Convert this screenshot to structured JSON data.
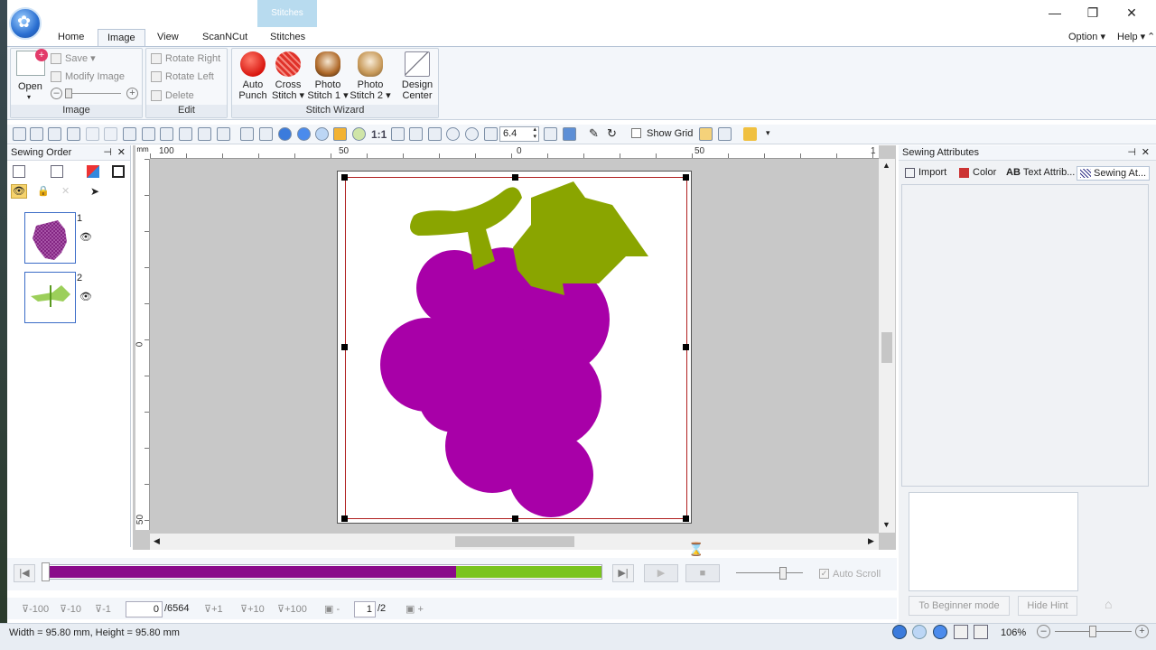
{
  "context_tab": "Stitches",
  "window_controls": {
    "minimize": "—",
    "restore": "❐",
    "close": "✕"
  },
  "menu": {
    "tabs": [
      "Home",
      "Image",
      "View",
      "ScanNCut",
      "Stitches"
    ],
    "active_tab": "Image",
    "option_label": "Option",
    "help_label": "Help"
  },
  "ribbon": {
    "image_group": {
      "label": "Image",
      "open_label": "Open",
      "save_label": "Save",
      "modify_label": "Modify Image"
    },
    "edit_group": {
      "label": "Edit",
      "rotate_right": "Rotate Right",
      "rotate_left": "Rotate Left",
      "delete": "Delete"
    },
    "wizard_group": {
      "label": "Stitch Wizard",
      "buttons": [
        {
          "line1": "Auto",
          "line2": "Punch",
          "icon": "apple-icon"
        },
        {
          "line1": "Cross",
          "line2": "Stitch ▾",
          "icon": "cross-apple-icon"
        },
        {
          "line1": "Photo",
          "line2": "Stitch 1 ▾",
          "icon": "dog-photo-icon"
        },
        {
          "line1": "Photo",
          "line2": "Stitch 2 ▾",
          "icon": "dog-photo2-icon"
        },
        {
          "line1": "Design",
          "line2": "Center",
          "icon": "design-center-icon"
        }
      ]
    }
  },
  "toolbar": {
    "one_to_one": "1:1",
    "zoom_value": "6.4",
    "show_grid_label": "Show Grid"
  },
  "sewing_order": {
    "title": "Sewing Order",
    "items": [
      {
        "number": "1",
        "color": "purple"
      },
      {
        "number": "2",
        "color": "green"
      }
    ]
  },
  "rulers": {
    "top": [
      "100",
      "50",
      "0",
      "50",
      "1"
    ],
    "left": [
      "0",
      "50"
    ]
  },
  "sewing_attributes": {
    "title": "Sewing Attributes",
    "tabs": [
      "Import",
      "Color",
      "Text Attrib...",
      "Sewing At..."
    ],
    "beginner_button": "To Beginner mode",
    "hide_hint_button": "Hide Hint"
  },
  "playback": {
    "auto_scroll_label": "Auto Scroll",
    "purple_fraction": 0.74,
    "colors": {
      "purple": "#8a0a8a",
      "green": "#7ac41f"
    }
  },
  "step_controls": {
    "buttons_left": [
      "-100",
      "-10",
      "-1"
    ],
    "stitch_value": "0",
    "stitch_total": "/6564",
    "buttons_right": [
      "+1",
      "+10",
      "+100"
    ],
    "minus": "-",
    "page_value": "1",
    "page_total": "/2",
    "plus": "+"
  },
  "status": {
    "dimensions": "Width  = 95.80 mm, Height = 95.80 mm",
    "zoom": "106%"
  }
}
